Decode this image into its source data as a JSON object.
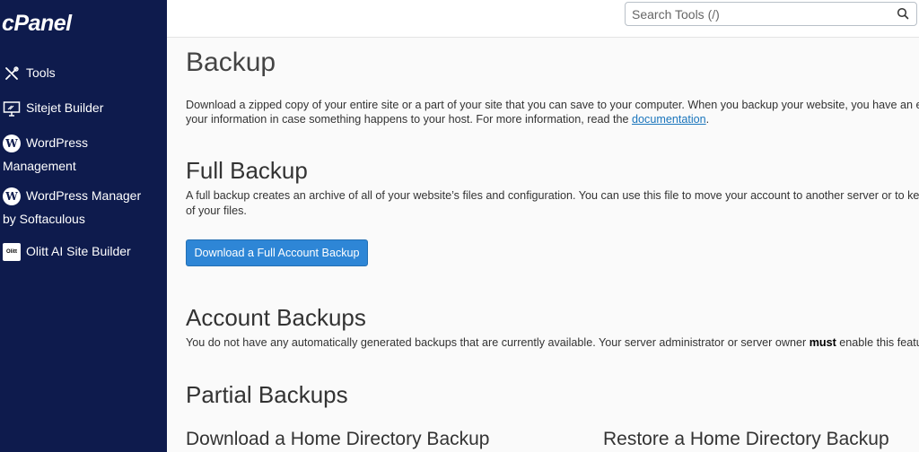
{
  "sidebar": {
    "logo": "cPanel",
    "items": [
      {
        "label": "Tools",
        "icon": "tools-icon"
      },
      {
        "label": "Sitejet Builder",
        "icon": "monitor-icon"
      },
      {
        "label_line1": "WordPress",
        "label_line2": "Management",
        "icon": "wordpress-icon"
      },
      {
        "label_line1": "WordPress Manager",
        "label_line2": "by Softaculous",
        "icon": "wordpress-icon"
      },
      {
        "label": "Olitt AI Site Builder",
        "icon": "olitt-icon",
        "icon_text": "Olitt"
      }
    ],
    "bg_color": "#0e1b4d"
  },
  "search": {
    "placeholder": "Search Tools (/)"
  },
  "page": {
    "title": "Backup",
    "intro_1": "Download a zipped copy of your entire site or a part of your site that you can save to your computer. When you backup your website, you have an ex",
    "intro_2": "your information in case something happens to your host. For more information, read the ",
    "intro_link": "documentation",
    "intro_end": ".",
    "full_backup": {
      "title": "Full Backup",
      "desc_1": "A full backup creates an archive of all of your website’s files and configuration. You can use this file to move your account to another server or to kee",
      "desc_2": "of your files.",
      "button": "Download a Full Account Backup"
    },
    "account_backups": {
      "title": "Account Backups",
      "desc_pre": "You do not have any automatically generated backups that are currently available. Your server administrator or server owner ",
      "desc_bold": "must",
      "desc_post": " enable this featu"
    },
    "partial_backups": {
      "title": "Partial Backups",
      "download_title": "Download a Home Directory Backup",
      "restore_title": "Restore a Home Directory Backup"
    }
  },
  "colors": {
    "accent": "#2e86d6",
    "link": "#1a75bc"
  }
}
